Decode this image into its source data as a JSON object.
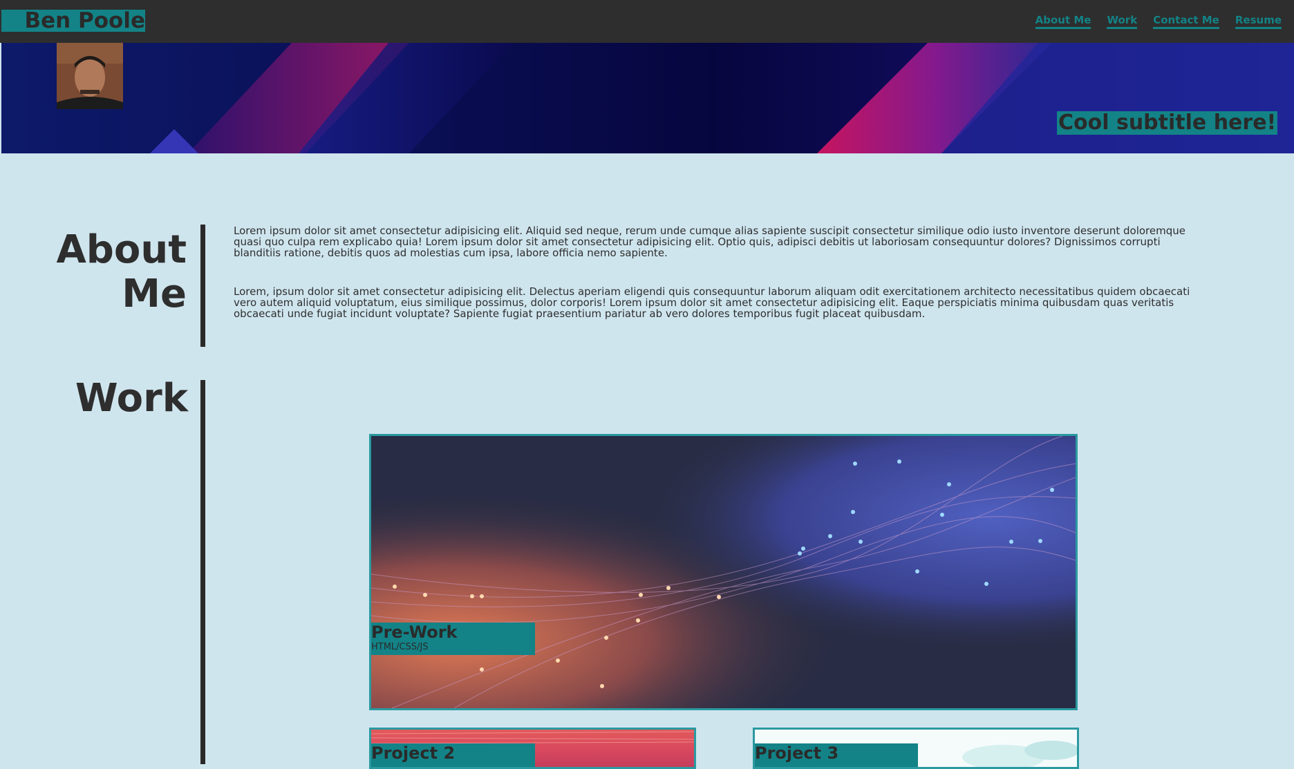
{
  "header": {
    "brand": "Ben Poole",
    "nav": [
      "About Me",
      "Work",
      "Contact Me",
      "Resume"
    ]
  },
  "hero": {
    "subtitle": "Cool subtitle here!"
  },
  "about": {
    "title_line1": "About",
    "title_line2": "Me",
    "paragraphs": [
      "Lorem ipsum dolor sit amet consectetur adipisicing elit. Aliquid sed neque, rerum unde cumque alias sapiente suscipit consectetur similique odio iusto inventore deserunt doloremque quasi quo culpa rem explicabo quia! Lorem ipsum dolor sit amet consectetur adipisicing elit. Optio quis, adipisci debitis ut laboriosam consequuntur dolores? Dignissimos corrupti blanditiis ratione, debitis quos ad molestias cum ipsa, labore officia nemo sapiente.",
      "Lorem, ipsum dolor sit amet consectetur adipisicing elit. Delectus aperiam eligendi quis consequuntur laborum aliquam odit exercitationem architecto necessitatibus quidem obcaecati vero autem aliquid voluptatum, eius similique possimus, dolor corporis! Lorem ipsum dolor sit amet consectetur adipisicing elit. Eaque perspiciatis minima quibusdam quas veritatis obcaecati unde fugiat incidunt voluptate? Sapiente fugiat praesentium pariatur ab vero dolores temporibus fugit placeat quibusdam."
    ]
  },
  "work": {
    "title": "Work",
    "projects": [
      {
        "title": "Pre-Work",
        "subtitle": "HTML/CSS/JS"
      },
      {
        "title": "Project 2"
      },
      {
        "title": "Project 3"
      }
    ]
  },
  "colors": {
    "accent": "#138387",
    "background": "#cfe5ee",
    "header": "#2e2e2e"
  }
}
